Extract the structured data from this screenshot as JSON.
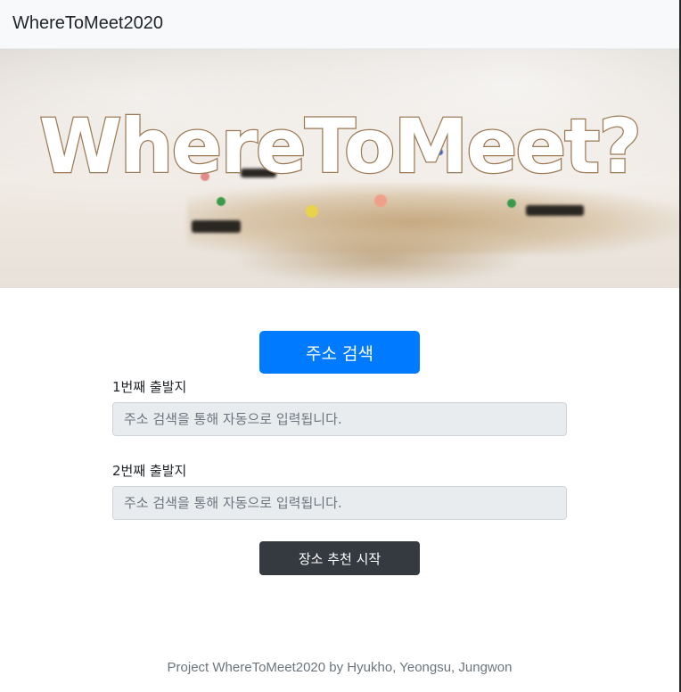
{
  "navbar": {
    "brand": "WhereToMeet2020"
  },
  "hero": {
    "title": "WhereToMeet?"
  },
  "search": {
    "button_label": "주소 검색"
  },
  "origins": [
    {
      "label": "1번째 출발지",
      "placeholder": "주소 검색을 통해 자동으로 입력됩니다.",
      "value": ""
    },
    {
      "label": "2번째 출발지",
      "placeholder": "주소 검색을 통해 자동으로 입력됩니다.",
      "value": ""
    }
  ],
  "start": {
    "button_label": "장소 추천 시작"
  },
  "footer": {
    "text": "Project WhereToMeet2020 by Hyukho, Yeongsu, Jungwon"
  },
  "colors": {
    "primary": "#007bff",
    "dark": "#343a40",
    "navbar_bg": "#f8f9fa",
    "input_bg": "#e9ecef",
    "muted": "#6c757d"
  }
}
